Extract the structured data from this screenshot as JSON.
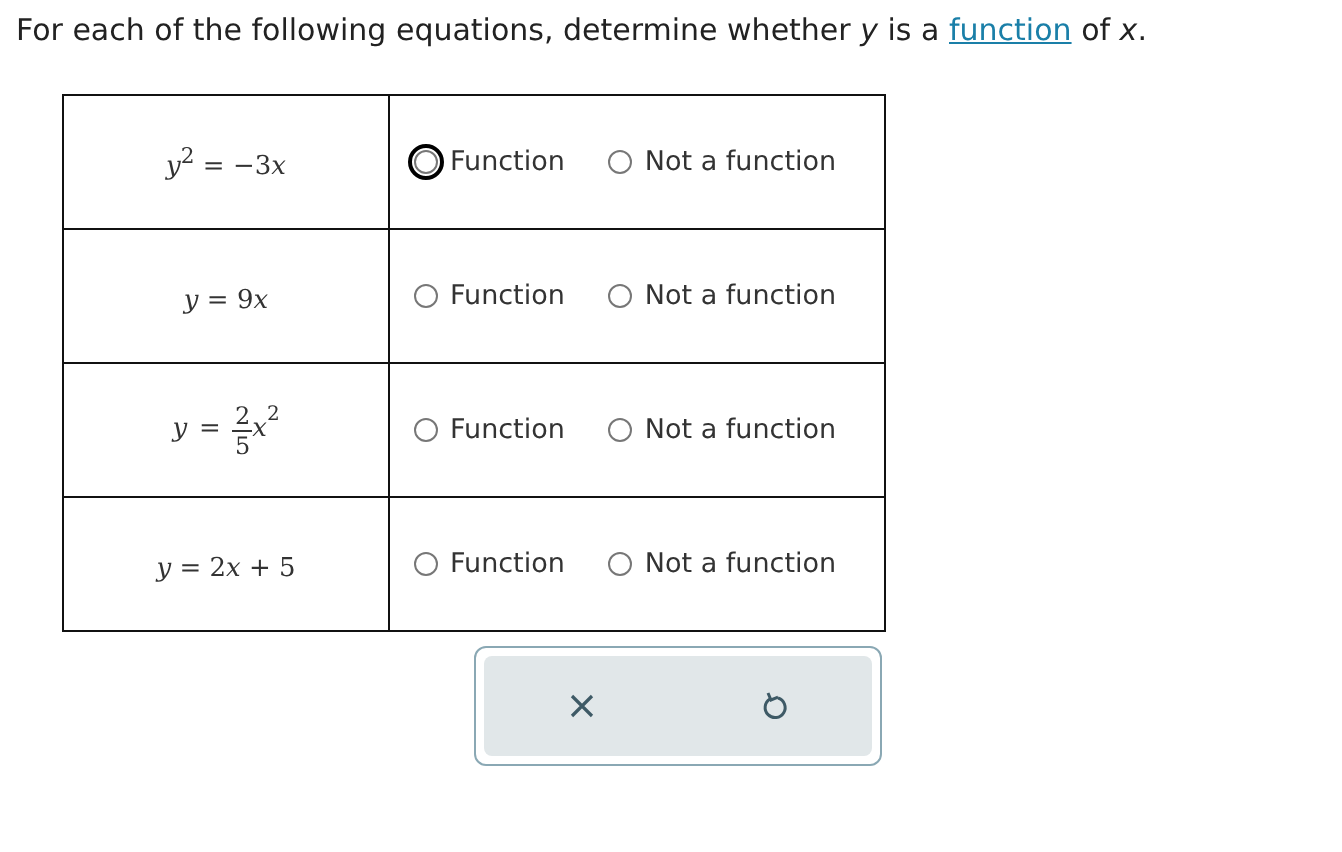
{
  "prompt": {
    "before": "For each of the following equations, determine whether *y* is a",
    "link": "function",
    "after": "of *x*."
  },
  "rows": [
    {
      "equation": {
        "kind": "inline",
        "parts": [
          {
            "kind": "var",
            "text": "y"
          },
          {
            "kind": "sup",
            "text": "2"
          },
          {
            "kind": "num",
            "text": " = −3"
          },
          {
            "kind": "var",
            "text": "x"
          }
        ]
      },
      "options": [
        {
          "label": "Function",
          "selected": false,
          "focused": true
        },
        {
          "label": "Not a function",
          "selected": false,
          "focused": false
        }
      ]
    },
    {
      "equation": {
        "kind": "inline",
        "parts": [
          {
            "kind": "var",
            "text": "y"
          },
          {
            "kind": "num",
            "text": " = 9"
          },
          {
            "kind": "var",
            "text": "x"
          }
        ]
      },
      "options": [
        {
          "label": "Function",
          "selected": false,
          "focused": false
        },
        {
          "label": "Not a function",
          "selected": false,
          "focused": false
        }
      ]
    },
    {
      "equation": {
        "kind": "fraction",
        "lhs": "y",
        "relation": "=",
        "numerator": "2",
        "denominator": "5",
        "variable": "x",
        "exponent": "2"
      },
      "options": [
        {
          "label": "Function",
          "selected": false,
          "focused": false
        },
        {
          "label": "Not a function",
          "selected": false,
          "focused": false
        }
      ]
    },
    {
      "equation": {
        "kind": "inline",
        "parts": [
          {
            "kind": "var",
            "text": "y"
          },
          {
            "kind": "num",
            "text": " = 2"
          },
          {
            "kind": "var",
            "text": "x"
          },
          {
            "kind": "num",
            "text": " + 5"
          }
        ]
      },
      "options": [
        {
          "label": "Function",
          "selected": false,
          "focused": false
        },
        {
          "label": "Not a function",
          "selected": false,
          "focused": false
        }
      ]
    }
  ],
  "actions": [
    {
      "kind": "clear"
    },
    {
      "kind": "undo"
    }
  ]
}
